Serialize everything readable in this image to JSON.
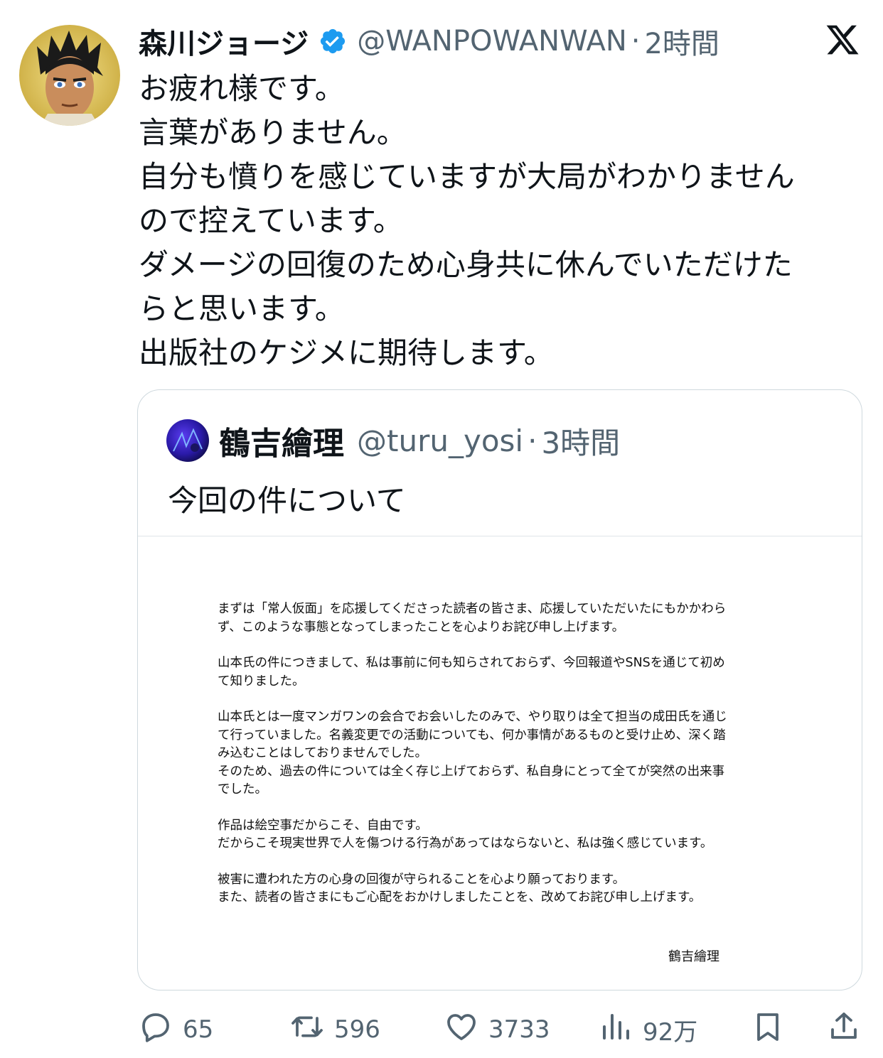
{
  "tweet": {
    "author_name": "森川ジョージ",
    "handle": "@WANPOWANWAN",
    "separator": "·",
    "time": "2時間",
    "lines": [
      "お疲れ様です。",
      "言葉がありません。",
      "自分も憤りを感じていますが大局がわかりません",
      "ので控えています。",
      "ダメージの回復のため心身共に休んでいただけた",
      "らと思います。",
      "出版社のケジメに期待します。"
    ]
  },
  "quote": {
    "author_name": "鶴吉繪理",
    "handle": "@turu_yosi",
    "separator": "·",
    "time": "3時間",
    "text": "今回の件について",
    "document": {
      "paragraphs": [
        [
          "まずは「常人仮面」を応援してくださった読者の皆さま、応援していただいたにもかかわら",
          "ず、このような事態となってしまったことを心よりお詫び申し上げます。"
        ],
        [
          "山本氏の件につきまして、私は事前に何も知らされておらず、今回報道やSNSを通じて初め",
          "て知りました。"
        ],
        [
          "山本氏とは一度マンガワンの会合でお会いしたのみで、やり取りは全て担当の成田氏を通じ",
          "て行っていました。名義変更での活動についても、何か事情があるものと受け止め、深く踏",
          "み込むことはしておりませんでした。",
          "そのため、過去の件については全く存じ上げておらず、私自身にとって全てが突然の出来事",
          "でした。"
        ],
        [
          "作品は絵空事だからこそ、自由です。",
          "だからこそ現実世界で人を傷つける行為があってはならないと、私は強く感じています。"
        ],
        [
          "被害に遭われた方の心身の回復が守られることを心より願っております。",
          "また、読者の皆さまにもご心配をおかけしましたことを、改めてお詫び申し上げます。"
        ]
      ],
      "signature": "鶴吉繪理"
    }
  },
  "actions": {
    "reply": {
      "icon": "reply-icon",
      "count": "65"
    },
    "retweet": {
      "icon": "retweet-icon",
      "count": "596"
    },
    "like": {
      "icon": "heart-icon",
      "count": "3733"
    },
    "views": {
      "icon": "views-icon",
      "count": "92万"
    },
    "bookmark": {
      "icon": "bookmark-icon"
    },
    "share": {
      "icon": "share-icon"
    }
  },
  "colors": {
    "text": "#0f1419",
    "secondary": "#536471",
    "verified": "#1d9bf0",
    "border": "#cfd9de"
  }
}
